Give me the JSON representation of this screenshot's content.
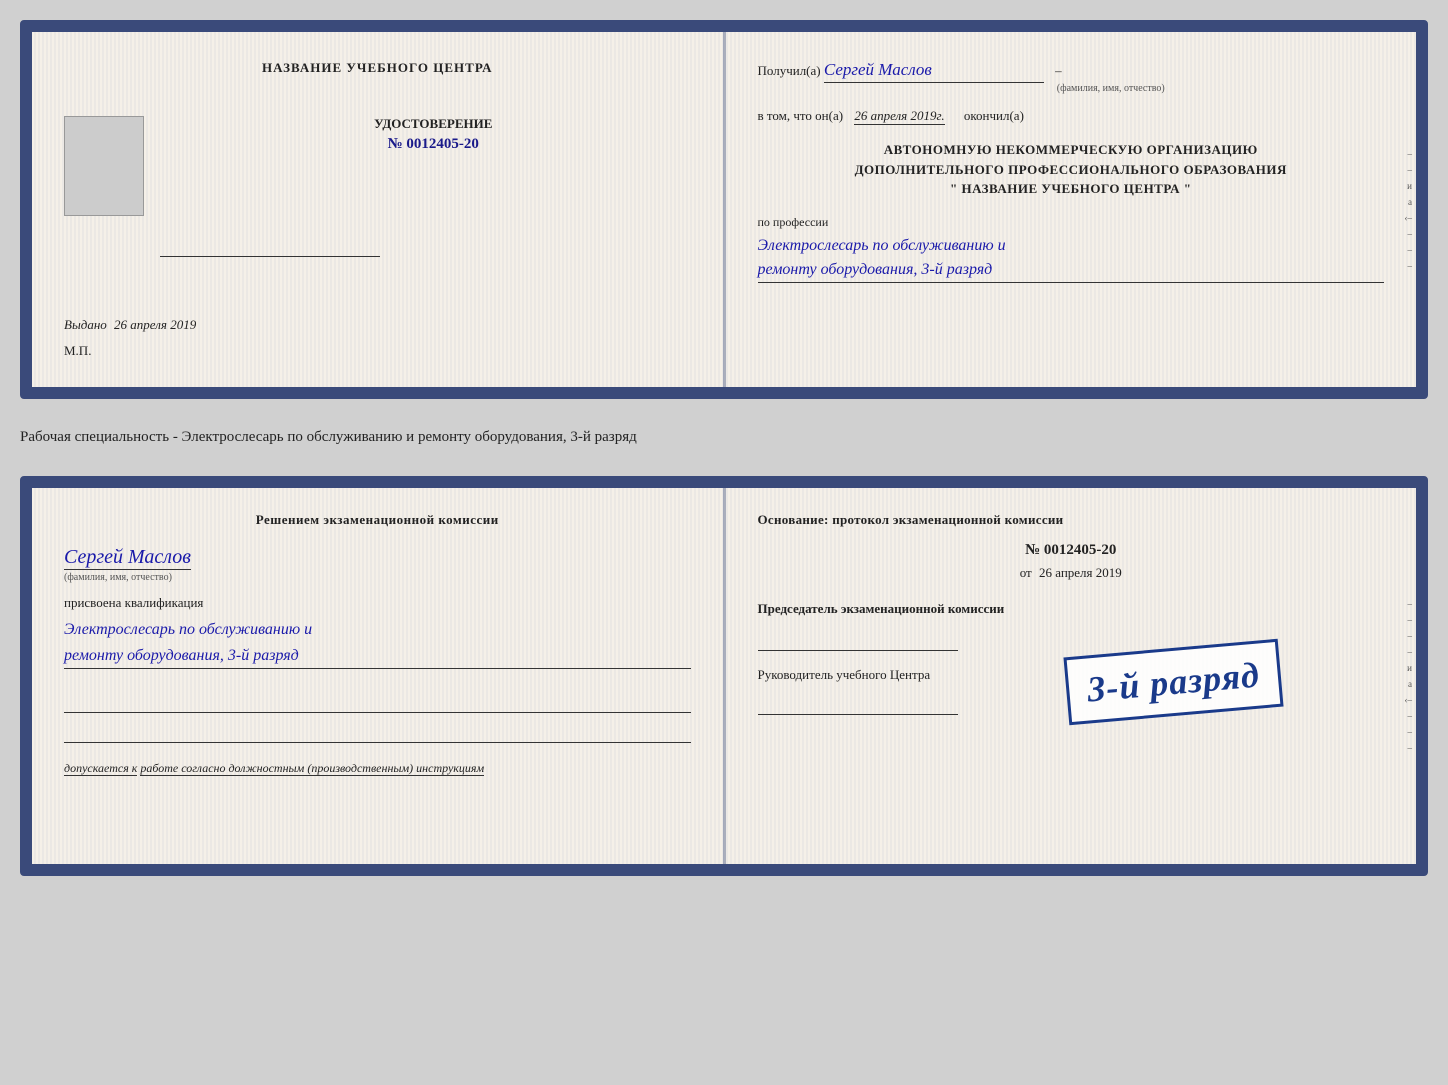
{
  "card1": {
    "left": {
      "title": "НАЗВАНИЕ УЧЕБНОГО ЦЕНТРА",
      "udostoverenie_label": "УДОСТОВЕРЕНИЕ",
      "number": "№ 0012405-20",
      "issued_label": "Выдано",
      "issued_date": "26 апреля 2019",
      "mp": "М.П."
    },
    "right": {
      "poluchil_label": "Получил(а)",
      "recipient_name": "Сергей Маслов",
      "fio_label": "(фамилия, имя, отчество)",
      "dash": "–",
      "vtom_label": "в том, что он(а)",
      "vtom_date": "26 апреля 2019г.",
      "okonchil_label": "окончил(а)",
      "org_line1": "АВТОНОМНУЮ НЕКОММЕРЧЕСКУЮ ОРГАНИЗАЦИЮ",
      "org_line2": "ДОПОЛНИТЕЛЬНОГО ПРОФЕССИОНАЛЬНОГО ОБРАЗОВАНИЯ",
      "org_name": "\" НАЗВАНИЕ УЧЕБНОГО ЦЕНТРА \"",
      "po_professii_label": "по профессии",
      "profession_line1": "Электрослесарь по обслуживанию и",
      "profession_line2": "ремонту оборудования, 3-й разряд"
    }
  },
  "separator": {
    "text": "Рабочая специальность - Электрослесарь по обслуживанию и ремонту оборудования, 3-й разряд"
  },
  "card2": {
    "left": {
      "title": "Решением экзаменационной комиссии",
      "name": "Сергей Маслов",
      "fio_label": "(фамилия, имя, отчество)",
      "prisvoena_label": "присвоена квалификация",
      "qualification_line1": "Электрослесарь по обслуживанию и",
      "qualification_line2": "ремонту оборудования, 3-й разряд",
      "dopuskaetsya_prefix": "допускается к",
      "dopuskaetsya_text": "работе согласно должностным (производственным) инструкциям"
    },
    "right": {
      "osnovanie_label": "Основание: протокол экзаменационной комиссии",
      "protocol_num": "№ 0012405-20",
      "ot_prefix": "от",
      "ot_date": "26 апреля 2019",
      "predsedatel_label": "Председатель экзаменационной комиссии",
      "rukovoditel_label": "Руководитель учебного Центра"
    },
    "stamp": {
      "text": "3-й разряд"
    }
  }
}
